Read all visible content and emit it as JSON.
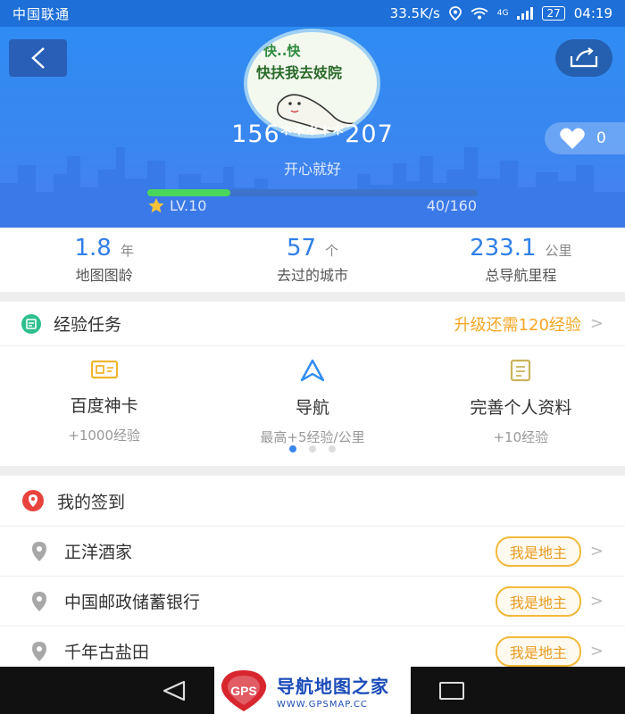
{
  "status_bar": {
    "carrier": "中国联通",
    "speed": "33.5K/s",
    "network": "4G",
    "battery": "27",
    "time": "04:19"
  },
  "header": {
    "avatar_text_line1": "快..快",
    "avatar_text_line2": "快扶我去妓院",
    "username": "156*****207",
    "signature": "开心就好",
    "likes": "0",
    "level": "LV.10",
    "exp_text": "40/160",
    "progress_fraction": 0.25,
    "accent_color": "#3a86f0",
    "progress_color": "#49d65a"
  },
  "stats": [
    {
      "value": "1.8",
      "unit": "年",
      "label": "地图图龄"
    },
    {
      "value": "57",
      "unit": "个",
      "label": "去过的城市"
    },
    {
      "value": "233.1",
      "unit": "公里",
      "label": "总导航里程"
    }
  ],
  "tasks": {
    "title": "经验任务",
    "hint": "升级还需120经验",
    "items": [
      {
        "name": "百度神卡",
        "desc": "+1000经验",
        "icon": "card-icon"
      },
      {
        "name": "导航",
        "desc": "最高+5经验/公里",
        "icon": "navigation-arrow-icon"
      },
      {
        "name": "完善个人资料",
        "desc": "+10经验",
        "icon": "document-icon"
      }
    ]
  },
  "checkin": {
    "title": "我的签到",
    "places": [
      {
        "name": "正洋酒家",
        "badge": "我是地主"
      },
      {
        "name": "中国邮政储蓄银行",
        "badge": "我是地主"
      },
      {
        "name": "千年古盐田",
        "badge": "我是地主"
      }
    ]
  },
  "watermark": {
    "mark": "GPS",
    "title": "导航地图之家",
    "url": "WWW.GPSMAP.CC"
  }
}
